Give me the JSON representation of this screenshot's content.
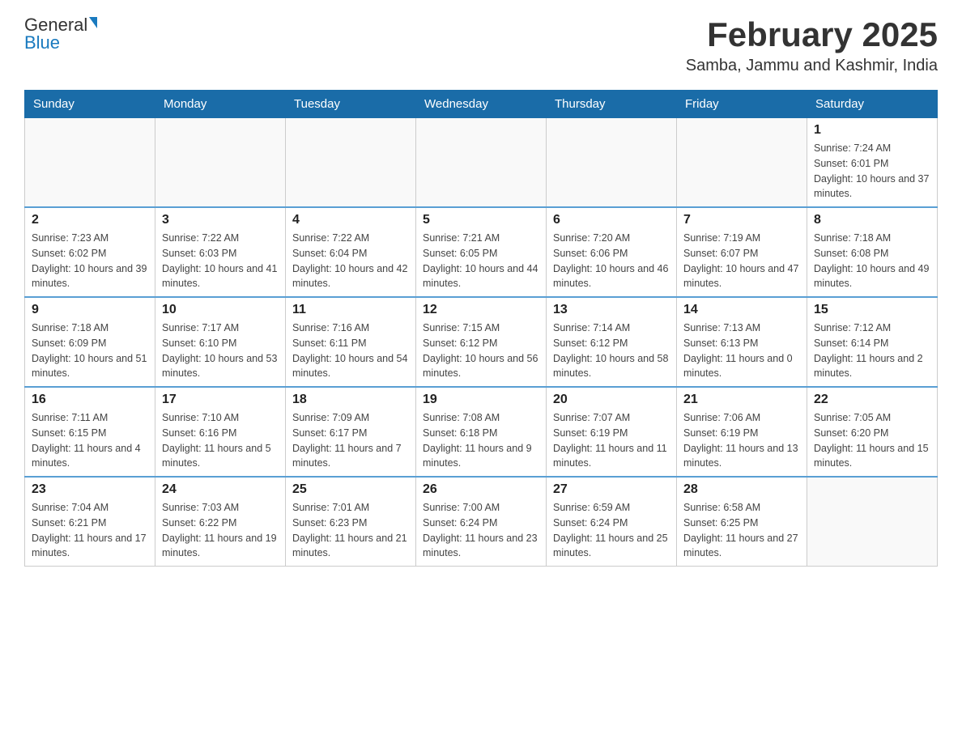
{
  "header": {
    "logo_general": "General",
    "logo_blue": "Blue",
    "month_title": "February 2025",
    "location": "Samba, Jammu and Kashmir, India"
  },
  "weekdays": [
    "Sunday",
    "Monday",
    "Tuesday",
    "Wednesday",
    "Thursday",
    "Friday",
    "Saturday"
  ],
  "weeks": [
    [
      {
        "day": "",
        "sunrise": "",
        "sunset": "",
        "daylight": ""
      },
      {
        "day": "",
        "sunrise": "",
        "sunset": "",
        "daylight": ""
      },
      {
        "day": "",
        "sunrise": "",
        "sunset": "",
        "daylight": ""
      },
      {
        "day": "",
        "sunrise": "",
        "sunset": "",
        "daylight": ""
      },
      {
        "day": "",
        "sunrise": "",
        "sunset": "",
        "daylight": ""
      },
      {
        "day": "",
        "sunrise": "",
        "sunset": "",
        "daylight": ""
      },
      {
        "day": "1",
        "sunrise": "Sunrise: 7:24 AM",
        "sunset": "Sunset: 6:01 PM",
        "daylight": "Daylight: 10 hours and 37 minutes."
      }
    ],
    [
      {
        "day": "2",
        "sunrise": "Sunrise: 7:23 AM",
        "sunset": "Sunset: 6:02 PM",
        "daylight": "Daylight: 10 hours and 39 minutes."
      },
      {
        "day": "3",
        "sunrise": "Sunrise: 7:22 AM",
        "sunset": "Sunset: 6:03 PM",
        "daylight": "Daylight: 10 hours and 41 minutes."
      },
      {
        "day": "4",
        "sunrise": "Sunrise: 7:22 AM",
        "sunset": "Sunset: 6:04 PM",
        "daylight": "Daylight: 10 hours and 42 minutes."
      },
      {
        "day": "5",
        "sunrise": "Sunrise: 7:21 AM",
        "sunset": "Sunset: 6:05 PM",
        "daylight": "Daylight: 10 hours and 44 minutes."
      },
      {
        "day": "6",
        "sunrise": "Sunrise: 7:20 AM",
        "sunset": "Sunset: 6:06 PM",
        "daylight": "Daylight: 10 hours and 46 minutes."
      },
      {
        "day": "7",
        "sunrise": "Sunrise: 7:19 AM",
        "sunset": "Sunset: 6:07 PM",
        "daylight": "Daylight: 10 hours and 47 minutes."
      },
      {
        "day": "8",
        "sunrise": "Sunrise: 7:18 AM",
        "sunset": "Sunset: 6:08 PM",
        "daylight": "Daylight: 10 hours and 49 minutes."
      }
    ],
    [
      {
        "day": "9",
        "sunrise": "Sunrise: 7:18 AM",
        "sunset": "Sunset: 6:09 PM",
        "daylight": "Daylight: 10 hours and 51 minutes."
      },
      {
        "day": "10",
        "sunrise": "Sunrise: 7:17 AM",
        "sunset": "Sunset: 6:10 PM",
        "daylight": "Daylight: 10 hours and 53 minutes."
      },
      {
        "day": "11",
        "sunrise": "Sunrise: 7:16 AM",
        "sunset": "Sunset: 6:11 PM",
        "daylight": "Daylight: 10 hours and 54 minutes."
      },
      {
        "day": "12",
        "sunrise": "Sunrise: 7:15 AM",
        "sunset": "Sunset: 6:12 PM",
        "daylight": "Daylight: 10 hours and 56 minutes."
      },
      {
        "day": "13",
        "sunrise": "Sunrise: 7:14 AM",
        "sunset": "Sunset: 6:12 PM",
        "daylight": "Daylight: 10 hours and 58 minutes."
      },
      {
        "day": "14",
        "sunrise": "Sunrise: 7:13 AM",
        "sunset": "Sunset: 6:13 PM",
        "daylight": "Daylight: 11 hours and 0 minutes."
      },
      {
        "day": "15",
        "sunrise": "Sunrise: 7:12 AM",
        "sunset": "Sunset: 6:14 PM",
        "daylight": "Daylight: 11 hours and 2 minutes."
      }
    ],
    [
      {
        "day": "16",
        "sunrise": "Sunrise: 7:11 AM",
        "sunset": "Sunset: 6:15 PM",
        "daylight": "Daylight: 11 hours and 4 minutes."
      },
      {
        "day": "17",
        "sunrise": "Sunrise: 7:10 AM",
        "sunset": "Sunset: 6:16 PM",
        "daylight": "Daylight: 11 hours and 5 minutes."
      },
      {
        "day": "18",
        "sunrise": "Sunrise: 7:09 AM",
        "sunset": "Sunset: 6:17 PM",
        "daylight": "Daylight: 11 hours and 7 minutes."
      },
      {
        "day": "19",
        "sunrise": "Sunrise: 7:08 AM",
        "sunset": "Sunset: 6:18 PM",
        "daylight": "Daylight: 11 hours and 9 minutes."
      },
      {
        "day": "20",
        "sunrise": "Sunrise: 7:07 AM",
        "sunset": "Sunset: 6:19 PM",
        "daylight": "Daylight: 11 hours and 11 minutes."
      },
      {
        "day": "21",
        "sunrise": "Sunrise: 7:06 AM",
        "sunset": "Sunset: 6:19 PM",
        "daylight": "Daylight: 11 hours and 13 minutes."
      },
      {
        "day": "22",
        "sunrise": "Sunrise: 7:05 AM",
        "sunset": "Sunset: 6:20 PM",
        "daylight": "Daylight: 11 hours and 15 minutes."
      }
    ],
    [
      {
        "day": "23",
        "sunrise": "Sunrise: 7:04 AM",
        "sunset": "Sunset: 6:21 PM",
        "daylight": "Daylight: 11 hours and 17 minutes."
      },
      {
        "day": "24",
        "sunrise": "Sunrise: 7:03 AM",
        "sunset": "Sunset: 6:22 PM",
        "daylight": "Daylight: 11 hours and 19 minutes."
      },
      {
        "day": "25",
        "sunrise": "Sunrise: 7:01 AM",
        "sunset": "Sunset: 6:23 PM",
        "daylight": "Daylight: 11 hours and 21 minutes."
      },
      {
        "day": "26",
        "sunrise": "Sunrise: 7:00 AM",
        "sunset": "Sunset: 6:24 PM",
        "daylight": "Daylight: 11 hours and 23 minutes."
      },
      {
        "day": "27",
        "sunrise": "Sunrise: 6:59 AM",
        "sunset": "Sunset: 6:24 PM",
        "daylight": "Daylight: 11 hours and 25 minutes."
      },
      {
        "day": "28",
        "sunrise": "Sunrise: 6:58 AM",
        "sunset": "Sunset: 6:25 PM",
        "daylight": "Daylight: 11 hours and 27 minutes."
      },
      {
        "day": "",
        "sunrise": "",
        "sunset": "",
        "daylight": ""
      }
    ]
  ]
}
